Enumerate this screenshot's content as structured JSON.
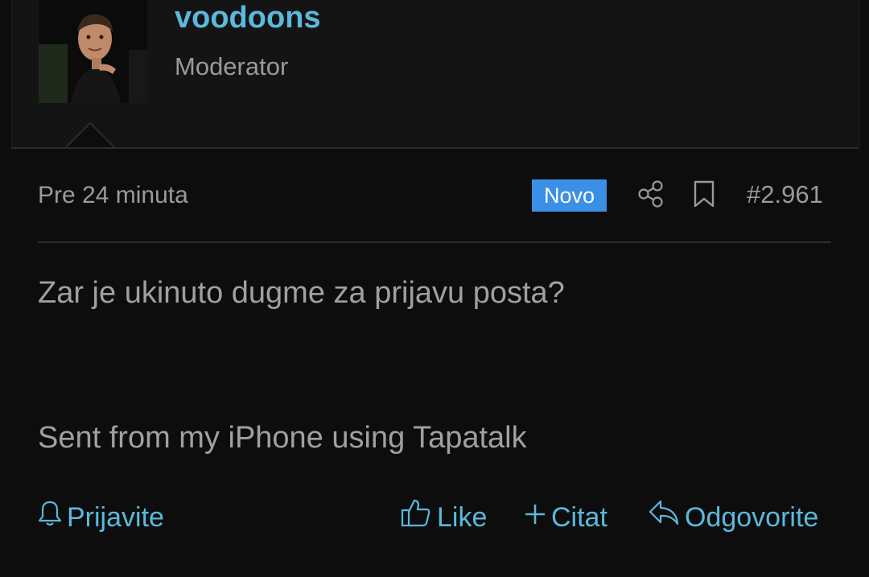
{
  "user": {
    "name": "voodoons",
    "title": "Moderator"
  },
  "post": {
    "time": "Pre 24 minuta",
    "badge": "Novo",
    "number": "#2.961",
    "lines": [
      "Zar je ukinuto dugme za prijavu posta?",
      "Sent from my iPhone using Tapatalk"
    ]
  },
  "actions": {
    "report": "Prijavite",
    "like": "Like",
    "quote": "Citat",
    "reply": "Odgovorite"
  },
  "icons": {
    "share": "share-icon",
    "bookmark": "bookmark-icon",
    "bell": "bell-icon",
    "thumb": "thumbs-up-icon",
    "plus": "plus-icon",
    "reply": "reply-arrow-icon"
  },
  "colors": {
    "background": "#0d0d0d",
    "link": "#5ab9dc",
    "badge": "#3a8fe6",
    "text": "#a0a0a0"
  }
}
